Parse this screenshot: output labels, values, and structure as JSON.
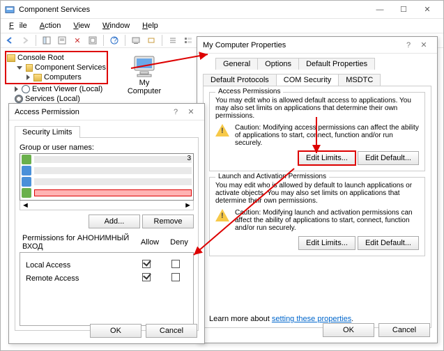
{
  "mainWindow": {
    "title": "Component Services",
    "menu": {
      "file": "File",
      "action": "Action",
      "view": "View",
      "window": "Window",
      "help": "Help"
    },
    "tree": {
      "root": "Console Root",
      "compServices": "Component Services",
      "computers": "Computers",
      "eventViewer": "Event Viewer (Local)",
      "services": "Services (Local)"
    },
    "desktopIcon": "My Computer"
  },
  "propDialog": {
    "title": "My Computer Properties",
    "tabsRow1": {
      "general": "General",
      "options": "Options",
      "defProps": "Default Properties"
    },
    "tabsRow2": {
      "defProto": "Default Protocols",
      "comSec": "COM Security",
      "msdtc": "MSDTC"
    },
    "access": {
      "heading": "Access Permissions",
      "intro": "You may edit who is allowed default access to applications. You may also set limits on applications that determine their own permissions.",
      "caution": "Caution: Modifying access permissions can affect the ability of applications to start, connect, function and/or run securely.",
      "editLimits": "Edit Limits...",
      "editDefault": "Edit Default..."
    },
    "launch": {
      "heading": "Launch and Activation Permissions",
      "intro": "You may edit who is allowed by default to launch applications or activate objects. You may also set limits on applications that determine their own permissions.",
      "caution": "Caution: Modifying launch and activation permissions can affect the ability of applications to start, connect, function and/or run securely.",
      "editLimits": "Edit Limits...",
      "editDefault": "Edit Default..."
    },
    "learnMore": "Learn more about ",
    "learnLink": "setting these properties",
    "ok": "OK",
    "cancel": "Cancel"
  },
  "accessDialog": {
    "title": "Access Permission",
    "tab": "Security Limits",
    "groupLabel": "Group or user names:",
    "scrollCount": "3",
    "add": "Add...",
    "remove": "Remove",
    "permissionsFor": "Permissions for АНОНИМНЫЙ ВХОД",
    "allow": "Allow",
    "deny": "Deny",
    "permRows": {
      "local": "Local Access",
      "remote": "Remote Access"
    },
    "permissions": {
      "local": {
        "allow": true,
        "deny": false
      },
      "remote": {
        "allow": true,
        "deny": false
      }
    },
    "ok": "OK",
    "cancel": "Cancel"
  }
}
